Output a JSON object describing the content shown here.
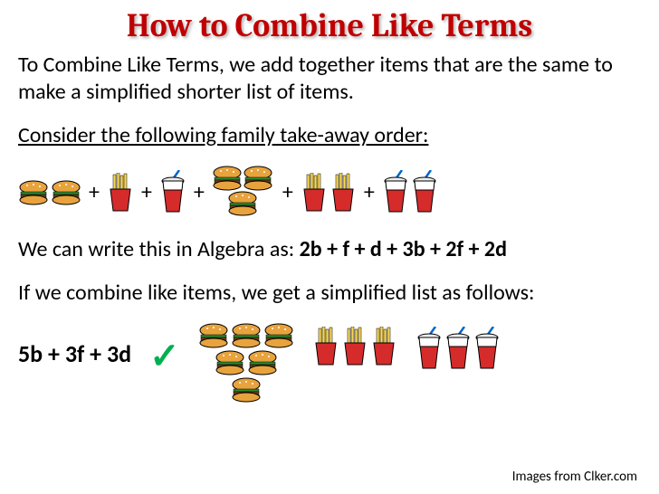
{
  "title": "How to Combine Like Terms",
  "intro": "To Combine Like Terms, we add together items that are the same to make a simplified shorter list of items.",
  "consider": "Consider the following family take-away order:",
  "algebra_text": "We can write this in Algebra as: ",
  "algebra_expr": "2b + f + d + 3b + 2f + 2d",
  "combine_text": "If we combine like items, we get a simplified list as follows:",
  "result_expr": "5b + 3f  + 3d",
  "credit": "Images from Clker.com",
  "plus": "+",
  "icons": {
    "burger": "burger-icon",
    "fries": "fries-icon",
    "drink": "drink-icon",
    "check": "checkmark-icon"
  }
}
